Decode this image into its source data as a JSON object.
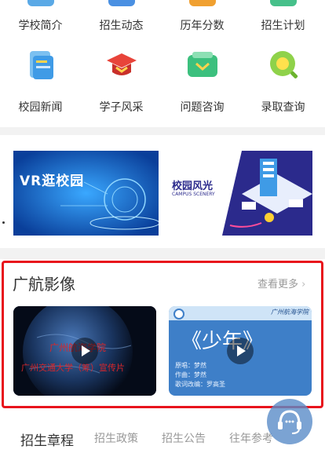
{
  "quick_links": {
    "row1": [
      {
        "label": "学校简介",
        "icon": "school-intro-icon"
      },
      {
        "label": "招生动态",
        "icon": "admission-news-icon"
      },
      {
        "label": "历年分数",
        "icon": "score-history-icon"
      },
      {
        "label": "招生计划",
        "icon": "admission-plan-icon"
      }
    ],
    "row2": [
      {
        "label": "校园新闻",
        "icon": "campus-news-icon"
      },
      {
        "label": "学子风采",
        "icon": "graduation-cap-icon"
      },
      {
        "label": "问题咨询",
        "icon": "message-icon"
      },
      {
        "label": "录取查询",
        "icon": "search-icon"
      }
    ]
  },
  "banners": {
    "vr_title": "VR逛校园",
    "campus_title": "校园风光",
    "campus_subtitle": "CAMPUS SCENERY"
  },
  "media_section": {
    "title": "广航影像",
    "more": "查看更多",
    "video1": {
      "line1": "广州航海学院",
      "line2": "广州交通大学（筹）宣传片"
    },
    "video2": {
      "header": "广州航海学院",
      "title": "《少年》",
      "credits": [
        "原唱：梦然",
        "作曲：梦然",
        "歌词改编：罗高圣"
      ]
    }
  },
  "tabs": [
    "招生章程",
    "招生政策",
    "招生公告",
    "往年参考"
  ],
  "colors": {
    "highlight_border": "#e8131c",
    "muted_text": "#999999"
  }
}
